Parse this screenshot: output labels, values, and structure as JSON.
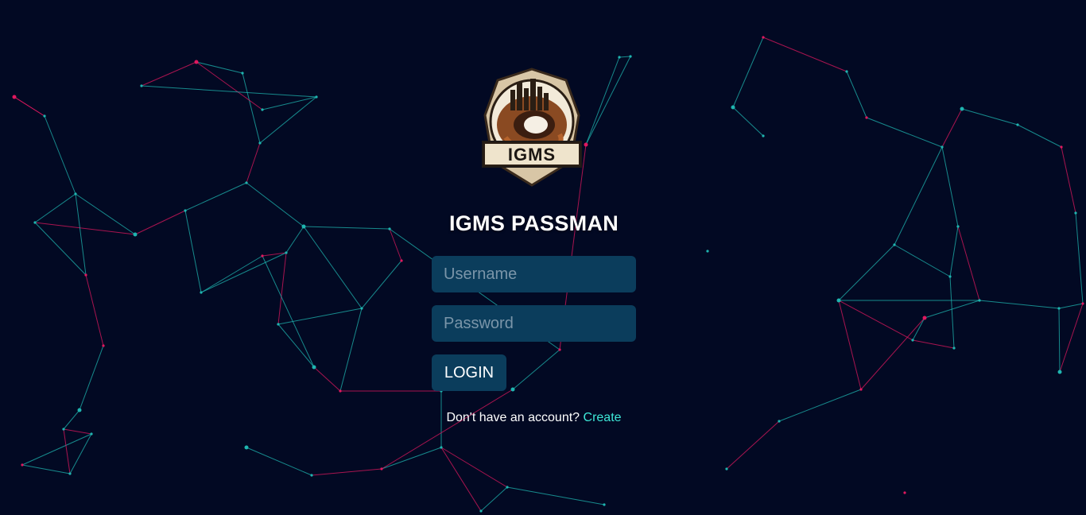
{
  "app": {
    "title": "IGMS PASSMAN",
    "logo_text": "IGMS"
  },
  "form": {
    "username_placeholder": "Username",
    "password_placeholder": "Password",
    "login_label": "LOGIN"
  },
  "signup": {
    "prompt": "Don't have an account?",
    "link_label": "Create"
  },
  "colors": {
    "background": "#020923",
    "input_bg": "#0b3d5c",
    "link": "#3ee8d8",
    "network_teal": "#1fb5b0",
    "network_pink": "#e0185f"
  }
}
